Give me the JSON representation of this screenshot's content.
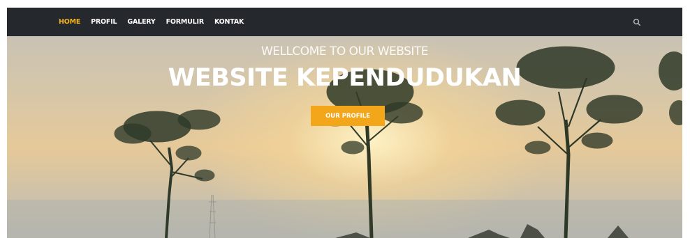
{
  "navbar": {
    "items": [
      {
        "label": "HOME",
        "active": true
      },
      {
        "label": "PROFIL",
        "active": false
      },
      {
        "label": "GALERY",
        "active": false
      },
      {
        "label": "FORMULIR",
        "active": false
      },
      {
        "label": "KONTAK",
        "active": false
      }
    ],
    "search_icon": "search-icon",
    "background_color": "#25282c",
    "active_color": "#f5b21b"
  },
  "hero": {
    "subtitle": "WELLCOME TO OUR WEBSITE",
    "title": "WEBSITE KEPENDUDUKAN",
    "button_label": "OUR PROFILE",
    "button_color": "#f4a61a"
  }
}
